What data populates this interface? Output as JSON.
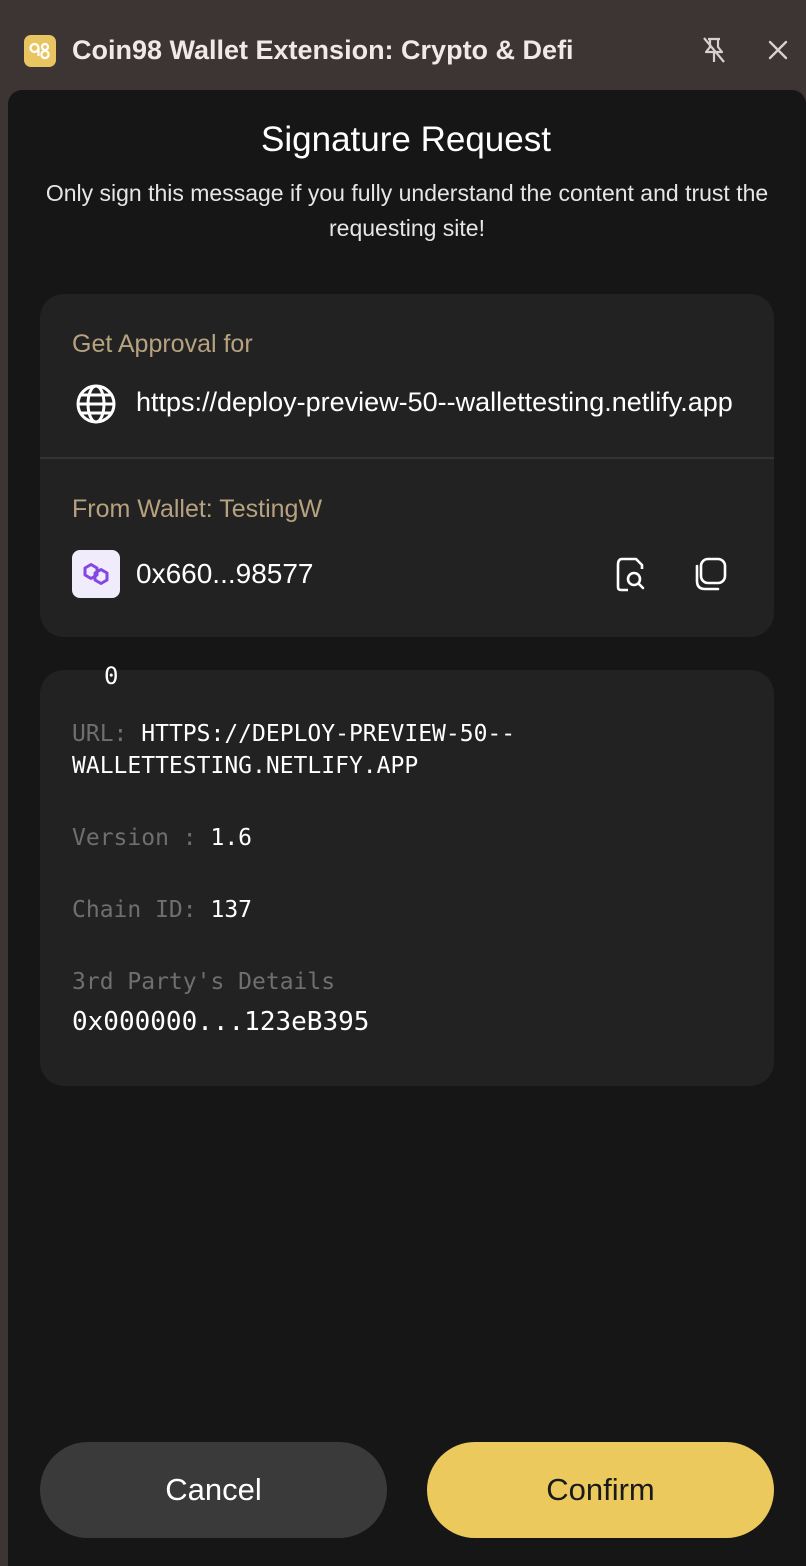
{
  "window": {
    "title": "Coin98 Wallet Extension: Crypto & Defi",
    "logo_text": "98",
    "icons": [
      "coin98-logo-icon",
      "pin-off-icon",
      "close-icon"
    ]
  },
  "header": {
    "title": "Signature Request",
    "warning": "Only sign this message if you fully understand the content and trust the requesting site!"
  },
  "approval": {
    "label": "Get Approval for",
    "site_url": "https://deploy-preview-50--wallettesting.netlify.app",
    "icon": "globe-icon"
  },
  "wallet": {
    "label": "From Wallet: TestingW",
    "address": "0x660...98577",
    "chain_icon": "polygon-icon",
    "actions": [
      "explorer-search-icon",
      "copy-icon"
    ]
  },
  "message": {
    "clipped_text": "0",
    "url_label": "URL:",
    "url_value_line1": "HTTPS://DEPLOY-PREVIEW-50--",
    "url_value_line2": "WALLETTESTING.NETLIFY.APP",
    "version_label": "Version :",
    "version_value": "1.6",
    "chain_label": "Chain ID:",
    "chain_value": "137",
    "third_party_label": "3rd Party's Details",
    "third_party_value": "0x000000...123eB395"
  },
  "actions": {
    "cancel": "Cancel",
    "confirm": "Confirm"
  },
  "colors": {
    "accent": "#ebc95d",
    "label_gold": "#b7a27f",
    "background": "#161616",
    "card": "#222222"
  }
}
